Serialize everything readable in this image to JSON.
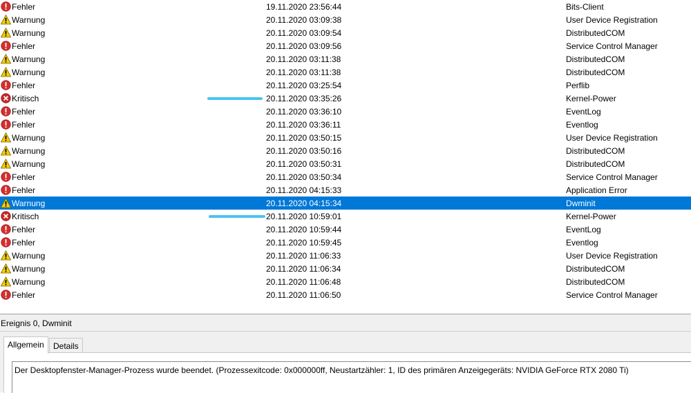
{
  "events": [
    {
      "level": "Fehler",
      "type": "error",
      "date": "19.11.2020 23:56:44",
      "source": "Bits-Client"
    },
    {
      "level": "Warnung",
      "type": "warning",
      "date": "20.11.2020 03:09:38",
      "source": "User Device Registration"
    },
    {
      "level": "Warnung",
      "type": "warning",
      "date": "20.11.2020 03:09:54",
      "source": "DistributedCOM"
    },
    {
      "level": "Fehler",
      "type": "error",
      "date": "20.11.2020 03:09:56",
      "source": "Service Control Manager"
    },
    {
      "level": "Warnung",
      "type": "warning",
      "date": "20.11.2020 03:11:38",
      "source": "DistributedCOM"
    },
    {
      "level": "Warnung",
      "type": "warning",
      "date": "20.11.2020 03:11:38",
      "source": "DistributedCOM"
    },
    {
      "level": "Fehler",
      "type": "error",
      "date": "20.11.2020 03:25:54",
      "source": "Perflib"
    },
    {
      "level": "Kritisch",
      "type": "critical",
      "date": "20.11.2020 03:35:26",
      "source": "Kernel-Power"
    },
    {
      "level": "Fehler",
      "type": "error",
      "date": "20.11.2020 03:36:10",
      "source": "EventLog"
    },
    {
      "level": "Fehler",
      "type": "error",
      "date": "20.11.2020 03:36:11",
      "source": "Eventlog"
    },
    {
      "level": "Warnung",
      "type": "warning",
      "date": "20.11.2020 03:50:15",
      "source": "User Device Registration"
    },
    {
      "level": "Warnung",
      "type": "warning",
      "date": "20.11.2020 03:50:16",
      "source": "DistributedCOM"
    },
    {
      "level": "Warnung",
      "type": "warning",
      "date": "20.11.2020 03:50:31",
      "source": "DistributedCOM"
    },
    {
      "level": "Fehler",
      "type": "error",
      "date": "20.11.2020 03:50:34",
      "source": "Service Control Manager"
    },
    {
      "level": "Fehler",
      "type": "error",
      "date": "20.11.2020 04:15:33",
      "source": "Application Error"
    },
    {
      "level": "Warnung",
      "type": "warning",
      "date": "20.11.2020 04:15:34",
      "source": "Dwminit",
      "selected": true
    },
    {
      "level": "Kritisch",
      "type": "critical",
      "date": "20.11.2020 10:59:01",
      "source": "Kernel-Power"
    },
    {
      "level": "Fehler",
      "type": "error",
      "date": "20.11.2020 10:59:44",
      "source": "EventLog"
    },
    {
      "level": "Fehler",
      "type": "error",
      "date": "20.11.2020 10:59:45",
      "source": "Eventlog"
    },
    {
      "level": "Warnung",
      "type": "warning",
      "date": "20.11.2020 11:06:33",
      "source": "User Device Registration"
    },
    {
      "level": "Warnung",
      "type": "warning",
      "date": "20.11.2020 11:06:34",
      "source": "DistributedCOM"
    },
    {
      "level": "Warnung",
      "type": "warning",
      "date": "20.11.2020 11:06:48",
      "source": "DistributedCOM"
    },
    {
      "level": "Fehler",
      "type": "error",
      "date": "20.11.2020 11:06:50",
      "source": "Service Control Manager"
    }
  ],
  "detail": {
    "title": "Ereignis 0, Dwminit",
    "tabs": [
      "Allgemein",
      "Details"
    ],
    "active_tab": "Allgemein",
    "description": "Der Desktopfenster-Manager-Prozess wurde beendet. (Prozessexitcode: 0x000000ff, Neustartzähler: 1, ID des primären Anzeigegeräts: NVIDIA GeForce RTX 2080 Ti)"
  },
  "colors": {
    "selection": "#0078d7",
    "error": "#d32f2f",
    "warning": "#f5d000",
    "critical": "#c62828",
    "redaction": "#4cc3f0"
  },
  "icons": {
    "error": "error-icon",
    "warning": "warning-icon",
    "critical": "critical-icon"
  }
}
